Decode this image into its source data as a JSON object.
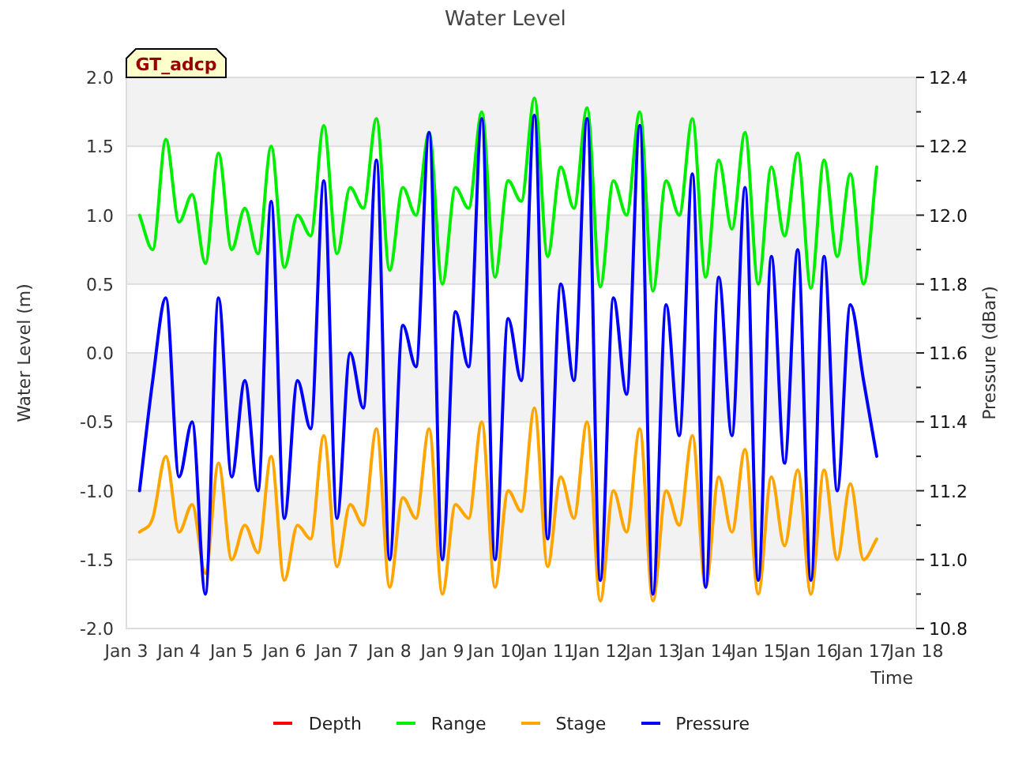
{
  "chart_data": {
    "type": "line",
    "title": "Water Level",
    "xlabel": "Time",
    "ylabel": "Water Level (m)",
    "ylim": [
      -2,
      2
    ],
    "grid": true,
    "yticks": [
      {
        "value": 2,
        "label": "2.0"
      },
      {
        "value": 1.5,
        "label": "1.5"
      },
      {
        "value": 1,
        "label": "1.0"
      },
      {
        "value": 0.5,
        "label": "0.5"
      },
      {
        "value": 0,
        "label": "0.0"
      },
      {
        "value": -0.5,
        "label": "-0.5"
      },
      {
        "value": -1,
        "label": "-1.0"
      },
      {
        "value": -1.5,
        "label": "-1.5"
      },
      {
        "value": -2,
        "label": "-2.0"
      }
    ],
    "y2label": "Pressure (dBar)",
    "y2lim": [
      10.8,
      12.4
    ],
    "y2ticks": [
      {
        "value": 12.4,
        "label": "12.4"
      },
      {
        "value": 12.2,
        "label": "12.2"
      },
      {
        "value": 12.0,
        "label": "12.0"
      },
      {
        "value": 11.8,
        "label": "11.8"
      },
      {
        "value": 11.6,
        "label": "11.6"
      },
      {
        "value": 11.4,
        "label": "11.4"
      },
      {
        "value": 11.2,
        "label": "11.2"
      },
      {
        "value": 11.0,
        "label": "11.0"
      },
      {
        "value": 10.8,
        "label": "10.8"
      }
    ],
    "annotations": [
      {
        "text": "GT_adcp"
      }
    ],
    "categories": [
      "Jan 3",
      null,
      null,
      null,
      "Jan 4",
      null,
      null,
      null,
      "Jan 5",
      null,
      null,
      null,
      "Jan 6",
      null,
      null,
      null,
      "Jan 7",
      null,
      null,
      null,
      "Jan 8",
      null,
      null,
      null,
      "Jan 9",
      null,
      null,
      null,
      "Jan 10",
      null,
      null,
      null,
      "Jan 11",
      null,
      null,
      null,
      "Jan 12",
      null,
      null,
      null,
      "Jan 13",
      null,
      null,
      null,
      "Jan 14",
      null,
      null,
      null,
      "Jan 15",
      null,
      null,
      null,
      "Jan 16",
      null,
      null,
      null,
      "Jan 17",
      null,
      null,
      null,
      "Jan 18"
    ],
    "series": [
      {
        "name": "Depth",
        "color": "#ff0000",
        "values": [
          null,
          null,
          null,
          null,
          null,
          null,
          null,
          null,
          null,
          null,
          null,
          null,
          null,
          null,
          null,
          null,
          null,
          null,
          null,
          null,
          null,
          null,
          null,
          null,
          null,
          null,
          null,
          null,
          null,
          null,
          null,
          null,
          null,
          null,
          null,
          null,
          null,
          null,
          null,
          null,
          null,
          null,
          null,
          null,
          null,
          null,
          null,
          null,
          null,
          null,
          null,
          null,
          null,
          null,
          null,
          null,
          null,
          null,
          null,
          null,
          null
        ]
      },
      {
        "name": "Range",
        "color": "#00ee00",
        "values": [
          null,
          1.0,
          0.75,
          1.55,
          0.95,
          1.15,
          0.65,
          1.45,
          0.75,
          1.05,
          0.72,
          1.5,
          0.62,
          1.0,
          0.85,
          1.65,
          0.72,
          1.2,
          1.05,
          1.7,
          0.6,
          1.2,
          1.0,
          1.6,
          0.5,
          1.2,
          1.05,
          1.75,
          0.55,
          1.25,
          1.1,
          1.85,
          0.7,
          1.35,
          1.05,
          1.78,
          0.48,
          1.25,
          1.0,
          1.75,
          0.45,
          1.25,
          1.0,
          1.7,
          0.55,
          1.4,
          0.9,
          1.6,
          0.5,
          1.35,
          0.85,
          1.45,
          0.47,
          1.4,
          0.7,
          1.3,
          0.5,
          1.35,
          null,
          null,
          null
        ]
      },
      {
        "name": "Stage",
        "color": "#ffa500",
        "values": [
          null,
          -1.3,
          -1.2,
          -0.75,
          -1.3,
          -1.1,
          -1.6,
          -0.8,
          -1.5,
          -1.25,
          -1.45,
          -0.75,
          -1.65,
          -1.25,
          -1.35,
          -0.6,
          -1.55,
          -1.1,
          -1.25,
          -0.55,
          -1.7,
          -1.05,
          -1.2,
          -0.55,
          -1.75,
          -1.1,
          -1.2,
          -0.5,
          -1.7,
          -1.0,
          -1.15,
          -0.4,
          -1.55,
          -0.9,
          -1.2,
          -0.5,
          -1.8,
          -1.0,
          -1.3,
          -0.55,
          -1.8,
          -1.0,
          -1.25,
          -0.6,
          -1.7,
          -0.9,
          -1.3,
          -0.7,
          -1.75,
          -0.9,
          -1.4,
          -0.85,
          -1.75,
          -0.85,
          -1.5,
          -0.95,
          -1.5,
          -1.35,
          null,
          null,
          null
        ]
      },
      {
        "name": "Pressure",
        "color": "#0000ff",
        "axis": "y2",
        "values": [
          null,
          11.2,
          11.52,
          11.76,
          11.24,
          11.4,
          10.9,
          11.76,
          11.24,
          11.52,
          11.2,
          12.04,
          11.12,
          11.52,
          11.38,
          12.1,
          11.12,
          11.6,
          11.44,
          12.16,
          11.0,
          11.68,
          11.56,
          12.24,
          11.0,
          11.72,
          11.56,
          12.28,
          11.0,
          11.7,
          11.52,
          12.29,
          11.06,
          11.8,
          11.52,
          12.28,
          10.94,
          11.76,
          11.48,
          12.26,
          10.9,
          11.74,
          11.36,
          12.12,
          10.92,
          11.82,
          11.36,
          12.08,
          10.94,
          11.88,
          11.28,
          11.9,
          10.94,
          11.88,
          11.2,
          11.74,
          11.52,
          11.3,
          null,
          null,
          null
        ]
      }
    ]
  }
}
